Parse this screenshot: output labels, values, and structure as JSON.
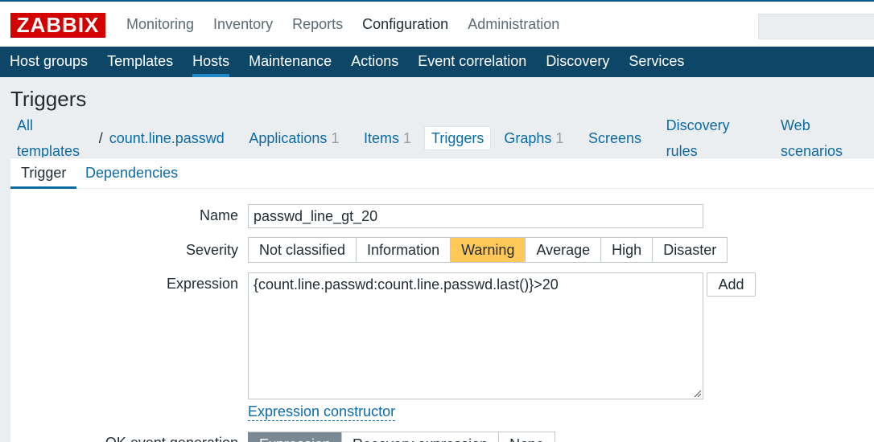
{
  "header": {
    "logo": "ZABBIX",
    "menu": [
      "Monitoring",
      "Inventory",
      "Reports",
      "Configuration",
      "Administration"
    ]
  },
  "subnav": [
    "Host groups",
    "Templates",
    "Hosts",
    "Maintenance",
    "Actions",
    "Event correlation",
    "Discovery",
    "Services"
  ],
  "page": {
    "title": "Triggers"
  },
  "hostnav": {
    "all_templates": "All templates",
    "separator": "/",
    "template": "count.line.passwd",
    "applications": "Applications",
    "applications_count": "1",
    "items": "Items",
    "items_count": "1",
    "triggers": "Triggers",
    "graphs": "Graphs",
    "graphs_count": "1",
    "screens": "Screens",
    "discovery_rules": "Discovery rules",
    "web_scenarios": "Web scenarios"
  },
  "tabs": [
    "Trigger",
    "Dependencies"
  ],
  "form": {
    "name_label": "Name",
    "name_value": "passwd_line_gt_20",
    "severity_label": "Severity",
    "severities": [
      "Not classified",
      "Information",
      "Warning",
      "Average",
      "High",
      "Disaster"
    ],
    "severity_selected": "Warning",
    "expression_label": "Expression",
    "expression_value": "{count.line.passwd:count.line.passwd.last()}>20",
    "add_button": "Add",
    "expression_constructor": "Expression constructor",
    "ok_event_label": "OK event generation",
    "ok_event_options": [
      "Expression",
      "Recovery expression",
      "None"
    ],
    "ok_event_selected": "Expression"
  },
  "colors": {
    "header_nav": "#0e4667",
    "link": "#0b6ba5",
    "logo": "#d40000",
    "warning": "#ffc859"
  }
}
